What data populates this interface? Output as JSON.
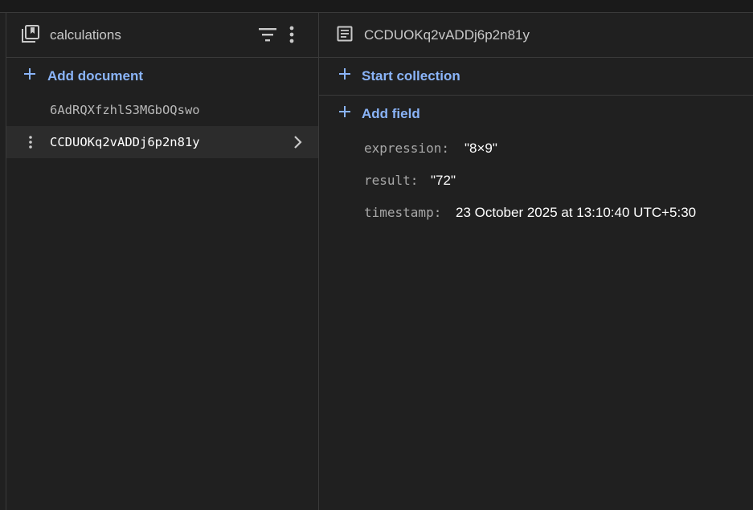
{
  "collection": {
    "title": "calculations",
    "add_document_label": "Add document",
    "documents": [
      {
        "id": "6AdRQXfzhlS3MGbOQswo",
        "selected": false
      },
      {
        "id": "CCDUOKq2vADDj6p2n81y",
        "selected": true
      }
    ]
  },
  "document": {
    "title": "CCDUOKq2vADDj6p2n81y",
    "start_collection_label": "Start collection",
    "add_field_label": "Add field",
    "fields": [
      {
        "key": "expression:",
        "value": "\"8×9\""
      },
      {
        "key": "result:",
        "value": "\"72\""
      },
      {
        "key": "timestamp:",
        "value": "23 October 2025 at 13:10:40 UTC+5:30"
      }
    ]
  },
  "colors": {
    "accent": "#8ab4f8",
    "background": "#202020",
    "selected_row": "#2c2c2c"
  },
  "icons": {
    "collection": "collection-icon",
    "filter": "filter-icon",
    "more": "more-vert-icon",
    "document": "document-icon",
    "add": "plus-icon",
    "chevron": "chevron-right-icon"
  }
}
